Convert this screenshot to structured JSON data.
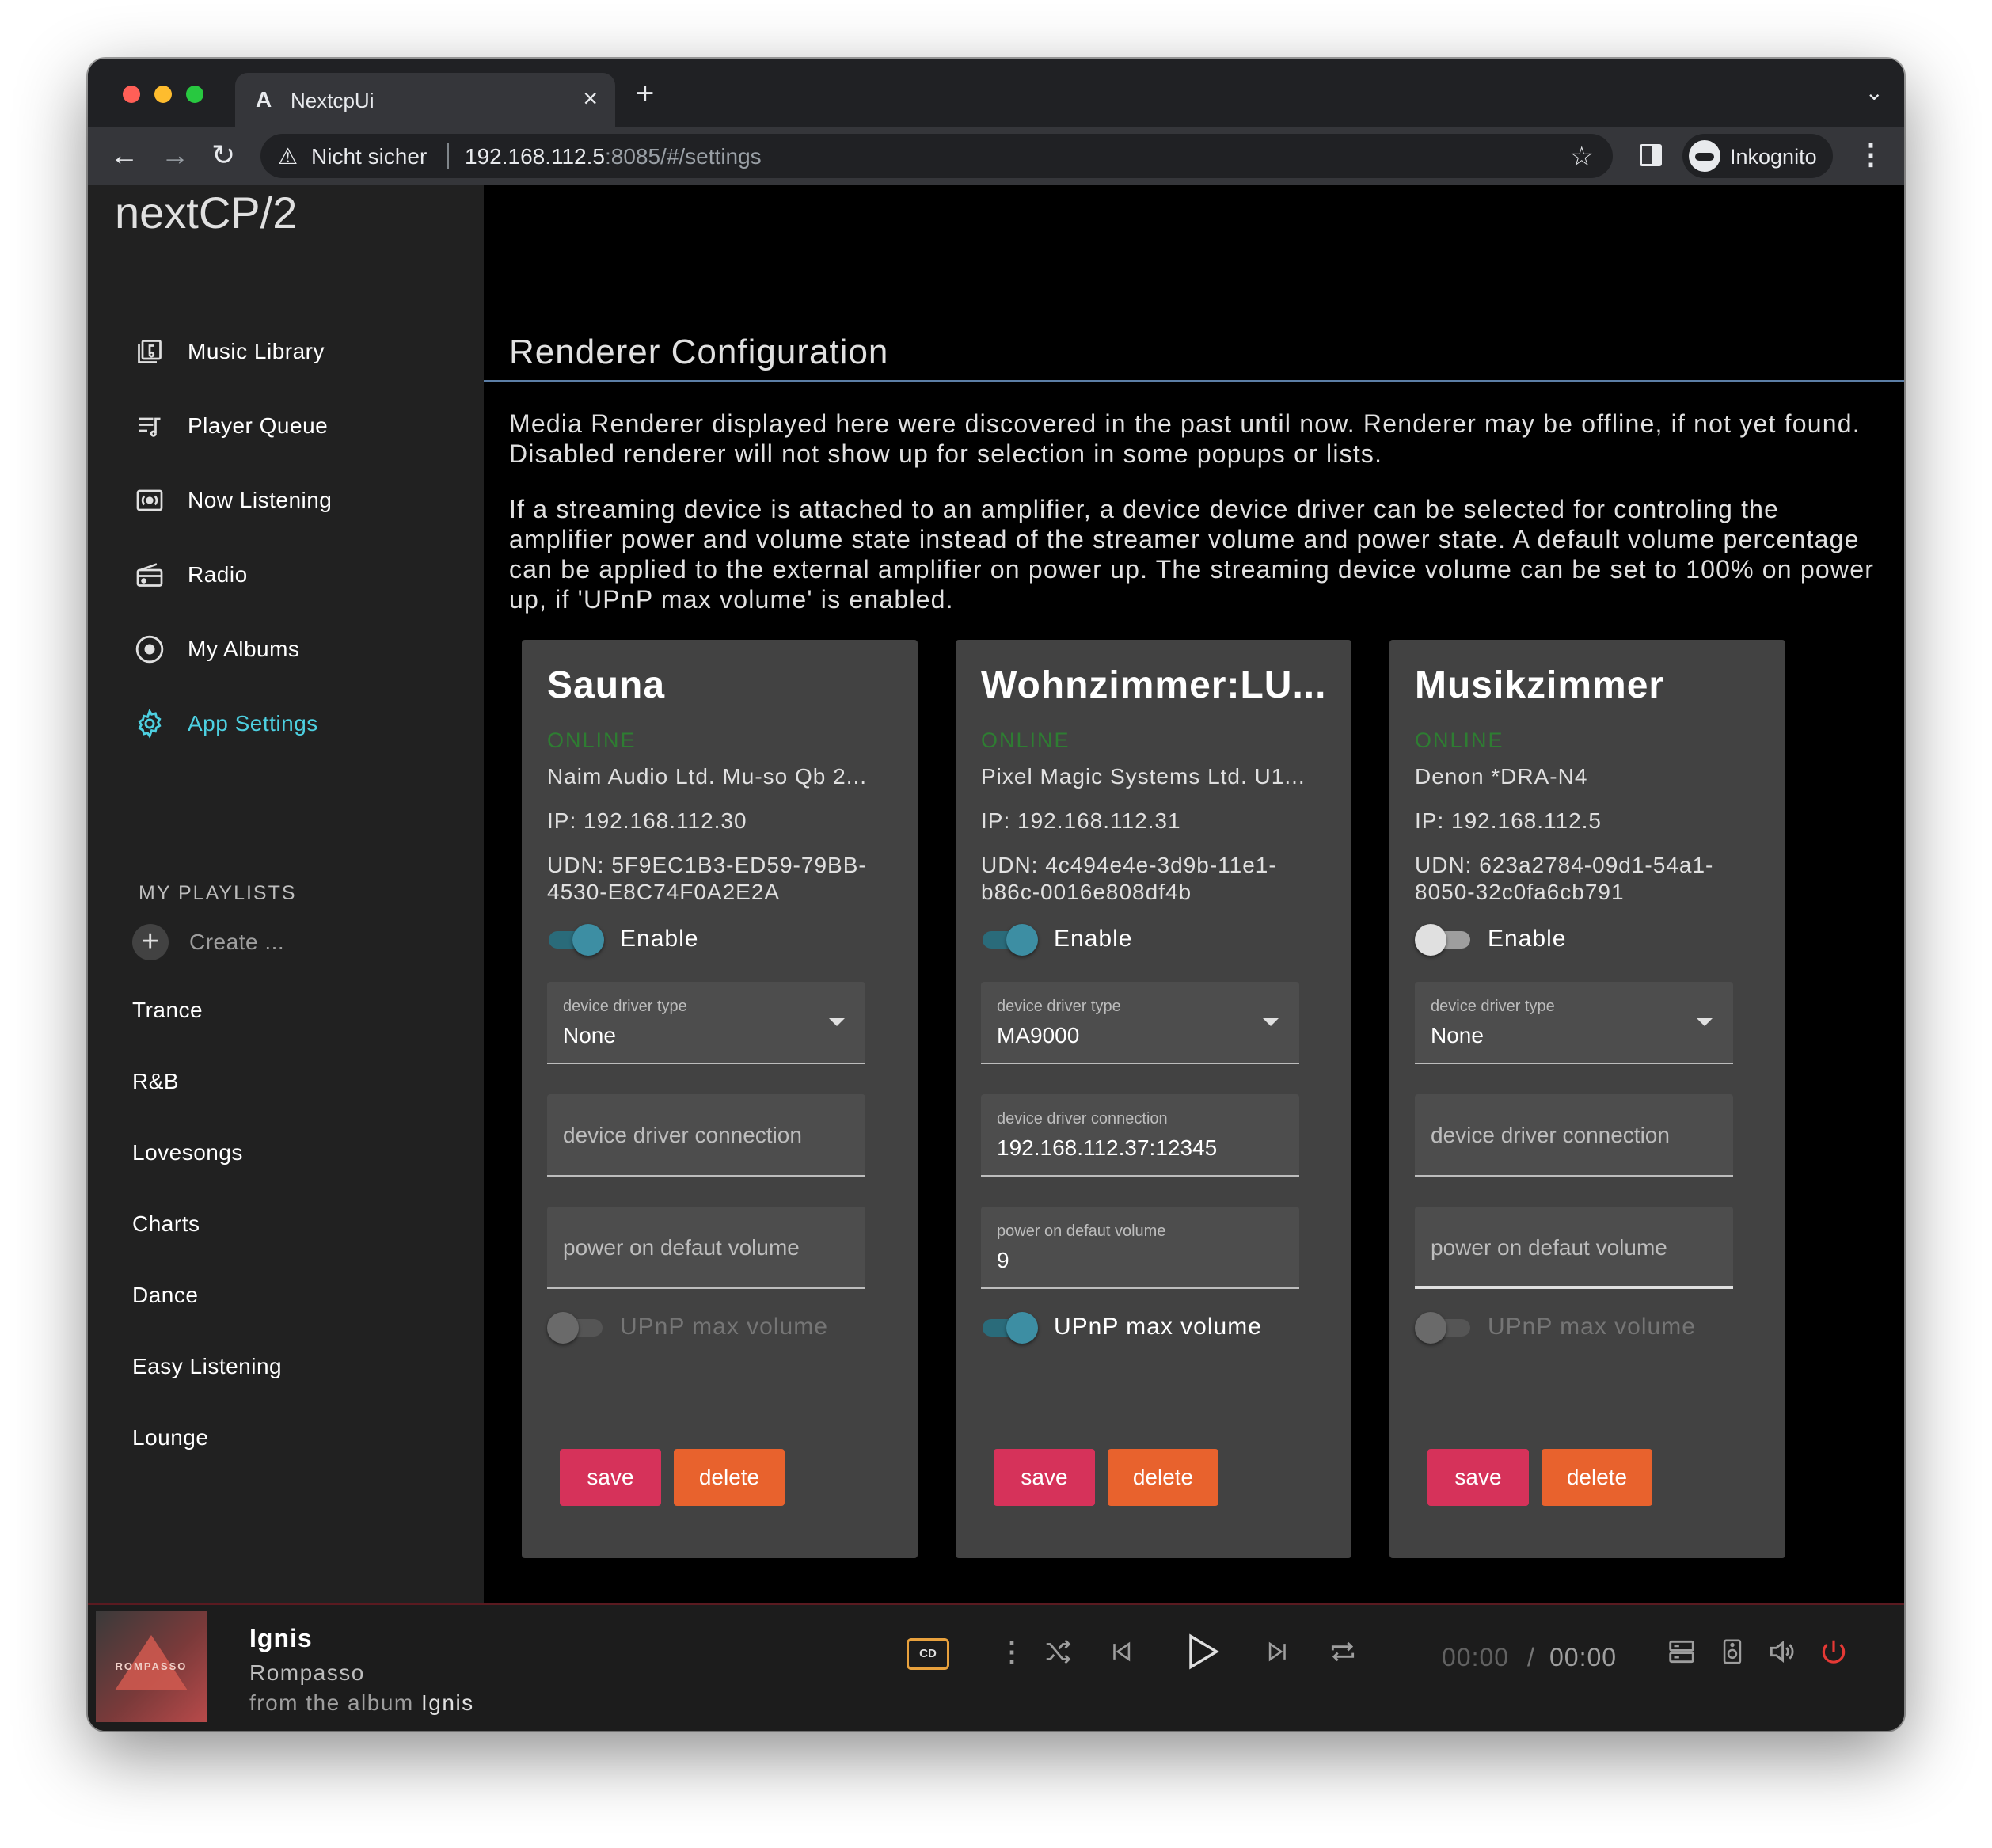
{
  "browser": {
    "tab_title": "NextcpUi",
    "security_text": "Nicht sicher",
    "url_host": "192.168.112.5",
    "url_rest": ":8085/#/settings",
    "profile_label": "Inkognito"
  },
  "sidebar": {
    "app_title": "nextCP/2",
    "nav": [
      {
        "label": "Music Library",
        "icon": "music-library-icon"
      },
      {
        "label": "Player Queue",
        "icon": "queue-icon"
      },
      {
        "label": "Now Listening",
        "icon": "now-listening-icon"
      },
      {
        "label": "Radio",
        "icon": "radio-icon"
      },
      {
        "label": "My Albums",
        "icon": "album-icon"
      },
      {
        "label": "App Settings",
        "icon": "gear-icon",
        "active": true
      }
    ],
    "playlists_header": "MY PLAYLISTS",
    "create_label": "Create ...",
    "playlists": [
      "Trance",
      "R&B",
      "Lovesongs",
      "Charts",
      "Dance",
      "Easy Listening",
      "Lounge"
    ]
  },
  "main": {
    "title": "Renderer Configuration",
    "paragraph_1": "Media Renderer displayed here were discovered in the past until now. Renderer may be offline, if not yet found. Disabled renderer will not show up for selection in some popups or lists.",
    "paragraph_2": "If a streaming device is attached to an amplifier, a device device driver can be selected for controling the amplifier power and volume state instead of the streamer volume and power state. A default volume percentage can be applied to the external amplifier on power up. The streaming device volume can be set to 100% on power up, if 'UPnP max volume' is enabled."
  },
  "labels": {
    "enable": "Enable",
    "driver_type": "device driver type",
    "driver_connection": "device driver connection",
    "default_volume": "power on defaut volume",
    "upnp_max": "UPnP max volume",
    "save": "save",
    "delete": "delete"
  },
  "renderers": [
    {
      "name": "Sauna",
      "status": "ONLINE",
      "model": "Naim Audio Ltd. Mu-so Qb 2...",
      "ip": "IP: 192.168.112.30",
      "udn": "UDN: 5F9EC1B3-ED59-79BB-4530-E8C74F0A2E2A",
      "enabled": true,
      "driver_type": "None",
      "driver_connection": "",
      "default_volume": "",
      "upnp_max": false,
      "upnp_disabled": true
    },
    {
      "name": "Wohnzimmer:LU...",
      "status": "ONLINE",
      "model": "Pixel Magic Systems Ltd. U1...",
      "ip": "IP: 192.168.112.31",
      "udn": "UDN: 4c494e4e-3d9b-11e1-b86c-0016e808df4b",
      "enabled": true,
      "driver_type": "MA9000",
      "driver_connection": "192.168.112.37:12345",
      "default_volume": "9",
      "upnp_max": true,
      "upnp_disabled": false
    },
    {
      "name": "Musikzimmer",
      "status": "ONLINE",
      "model": "Denon *DRA-N4",
      "ip": "IP: 192.168.112.5",
      "udn": "UDN: 623a2784-09d1-54a1-8050-32c0fa6cb791",
      "enabled": false,
      "driver_type": "None",
      "driver_connection": "",
      "default_volume": "",
      "upnp_max": false,
      "upnp_disabled": true
    }
  ],
  "player": {
    "title": "Ignis",
    "artist": "Rompasso",
    "album_prefix": "from the album",
    "album": "Ignis",
    "cover_text": "ROMPASSO",
    "cd_badge": "CD",
    "time_elapsed": "00:00",
    "time_sep": "/",
    "time_total": "00:00",
    "accent_power": "#e53935"
  }
}
